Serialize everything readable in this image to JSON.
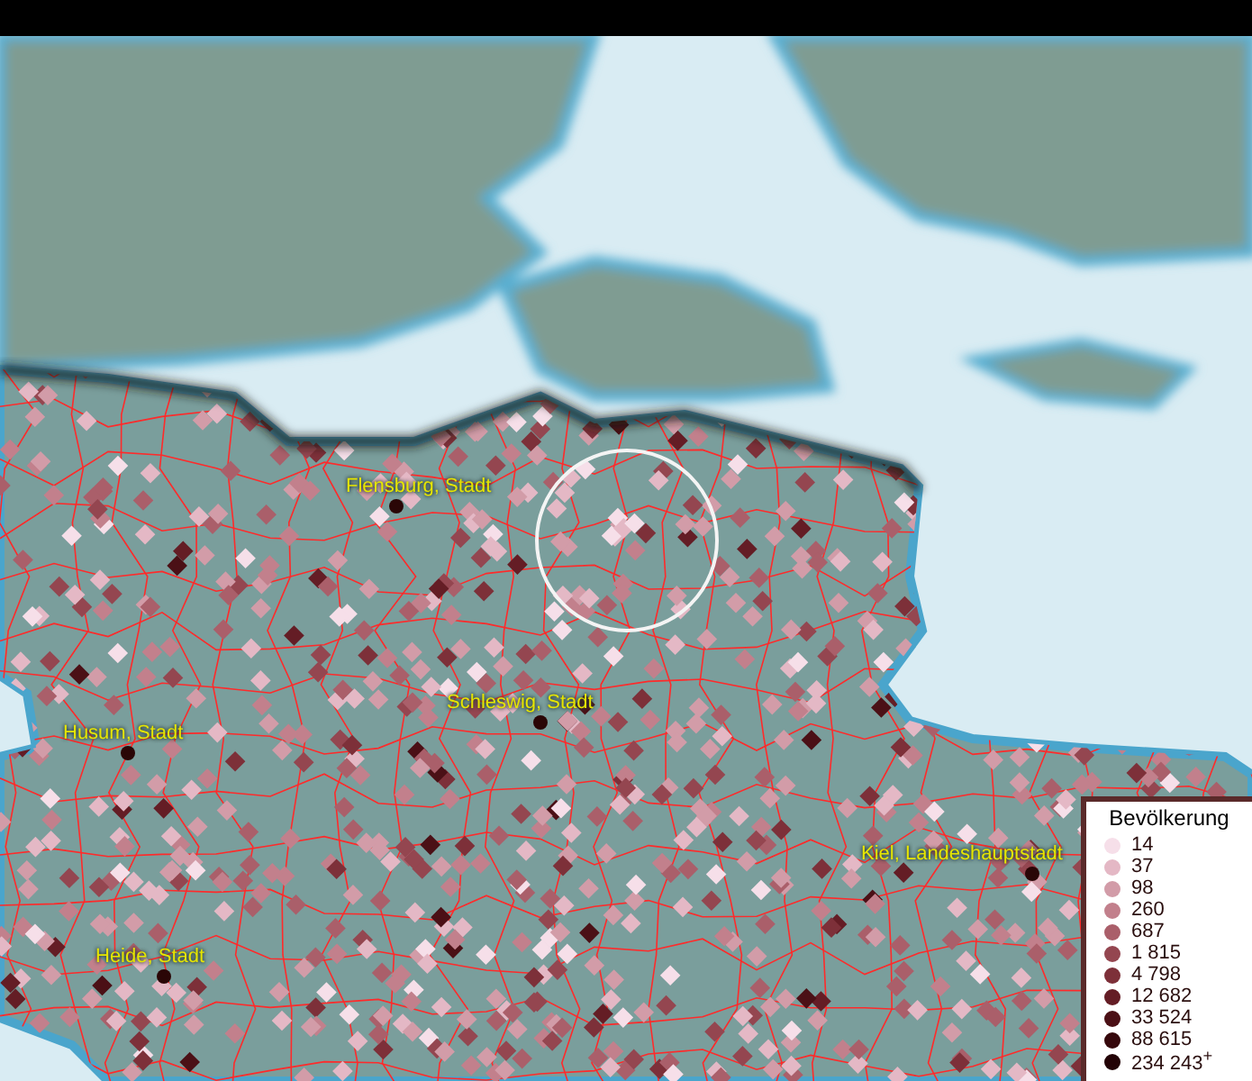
{
  "map": {
    "places": [
      {
        "label": "Flensburg, Stadt"
      },
      {
        "label": "Schleswig, Stadt"
      },
      {
        "label": "Husum, Stadt"
      },
      {
        "label": "Kiel, Landeshauptstadt"
      },
      {
        "label": "Heide, Stadt"
      }
    ]
  },
  "legend": {
    "title": "Bevölkerung",
    "items": [
      {
        "label": "14",
        "color": "#f6dfe9"
      },
      {
        "label": "37",
        "color": "#e4b8c5"
      },
      {
        "label": "98",
        "color": "#d29ca8"
      },
      {
        "label": "260",
        "color": "#c2808c"
      },
      {
        "label": "687",
        "color": "#aa5f6a"
      },
      {
        "label": "1 815",
        "color": "#944650"
      },
      {
        "label": "4 798",
        "color": "#7d3039"
      },
      {
        "label": "12 682",
        "color": "#641d25"
      },
      {
        "label": "33 524",
        "color": "#4b1016"
      },
      {
        "label": "88 615",
        "color": "#36080c"
      },
      {
        "label": "234 243$^{+}$",
        "color": "#230306"
      }
    ]
  }
}
